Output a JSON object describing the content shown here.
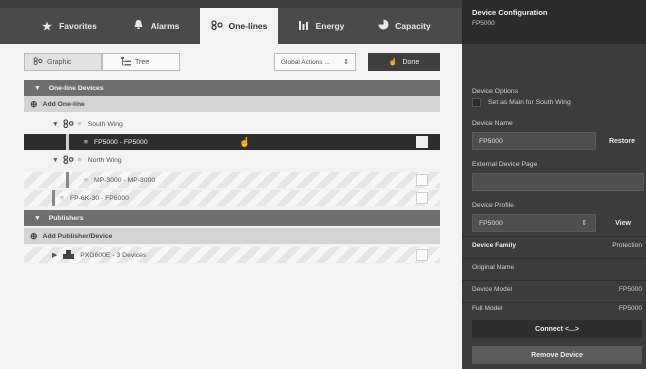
{
  "tabs": [
    {
      "label": "Favorites",
      "icon": "star-icon"
    },
    {
      "label": "Alarms",
      "icon": "bell-icon"
    },
    {
      "label": "One-lines",
      "icon": "one-line-icon"
    },
    {
      "label": "Energy",
      "icon": "bar-chart-icon"
    },
    {
      "label": "Capacity",
      "icon": "pie-icon"
    }
  ],
  "toolbar": {
    "graphic_label": "Graphic",
    "tree_label": "Tree",
    "global_actions": "Global Actions ...",
    "done_label": "Done"
  },
  "tree": {
    "one_line_devices": "One-line Devices",
    "add_one_line": "Add One-line",
    "south_wing": "South Wing",
    "fp5000": "FP5000 - FP5000",
    "north_wing": "North Wing",
    "mp3000": "MP-3000 - MP-3000",
    "fp6k": "FP-6K-30 - FP6000",
    "publishers": "Publishers",
    "add_publisher": "Add Publisher/Device",
    "pxg": "PXG600E - 3 Devices"
  },
  "side": {
    "title": "Device Configuration",
    "subtitle": "FP5000",
    "device_options": "Device Options",
    "set_main": "Set as Main for South Wing",
    "device_name_label": "Device Name",
    "device_name_value": "FP5000",
    "restore": "Restore",
    "external_page_label": "External Device Page",
    "external_page_value": "",
    "device_profile_label": "Device Profile",
    "device_profile_value": "FP5000",
    "view": "View",
    "device_family": "Device Family",
    "device_family_value": "Protection",
    "original_name": "Original Name",
    "original_name_value": "",
    "device_model": "Device Model",
    "device_model_value": "FP5000",
    "full_model": "Full Model",
    "full_model_value": "FP5000",
    "connect": "Connect <...>",
    "remove": "Remove Device"
  },
  "colors": {
    "tab_bar": "#4a4a4a",
    "main_bg": "#f3f3f3",
    "side_bg": "#3c3c3c",
    "selected_row": "#2e2e2e"
  }
}
